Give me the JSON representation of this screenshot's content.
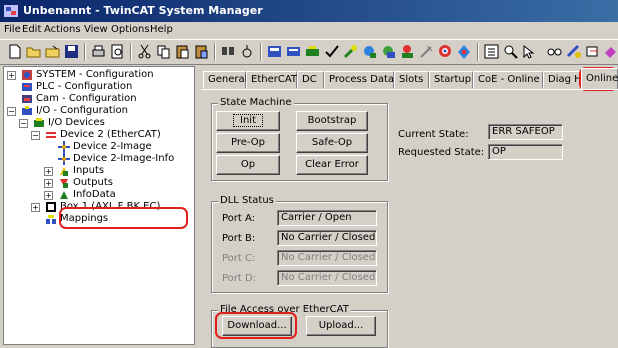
{
  "window": {
    "title": "Unbenannt - TwinCAT System Manager"
  },
  "menu": [
    "File",
    "Edit",
    "Actions",
    "View",
    "Options",
    "Help"
  ],
  "tree": {
    "system": "SYSTEM - Configuration",
    "plc": "PLC - Configuration",
    "cam": "Cam - Configuration",
    "io": "I/O - Configuration",
    "io_devices": "I/O Devices",
    "device2": "Device 2 (EtherCAT)",
    "image": "Device 2-Image",
    "image_info": "Device 2-Image-Info",
    "inputs": "Inputs",
    "outputs": "Outputs",
    "infodata": "InfoData",
    "box1": "Box 1 (AXL F BK EC)",
    "mappings": "Mappings"
  },
  "tabs": [
    "General",
    "EtherCAT",
    "DC",
    "Process Data",
    "Slots",
    "Startup",
    "CoE - Online",
    "Diag History",
    "Online"
  ],
  "state_machine": {
    "title": "State Machine",
    "init": "Init",
    "bootstrap": "Bootstrap",
    "preop": "Pre-Op",
    "safeop": "Safe-Op",
    "op": "Op",
    "clear_error": "Clear Error",
    "current_state_label": "Current State:",
    "current_state": "ERR SAFEOP",
    "requested_state_label": "Requested State:",
    "requested_state": "OP"
  },
  "dll_status": {
    "title": "DLL Status",
    "port_a_label": "Port A:",
    "port_a": "Carrier / Open",
    "port_b_label": "Port B:",
    "port_b": "No Carrier / Closed",
    "port_c_label": "Port C:",
    "port_c": "No Carrier / Closed",
    "port_d_label": "Port D:",
    "port_d": "No Carrier / Closed"
  },
  "file_access": {
    "title": "File Access over EtherCAT",
    "download": "Download...",
    "upload": "Upload..."
  },
  "colors": {
    "highlight": "#e0201c",
    "titlebar": "#0a246a"
  }
}
